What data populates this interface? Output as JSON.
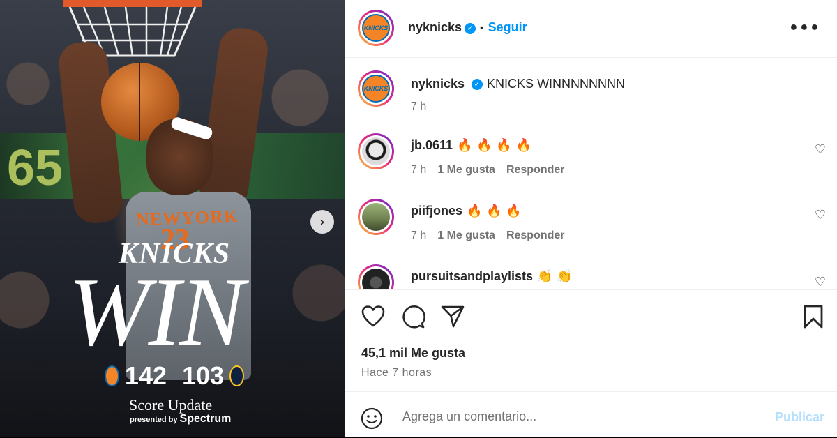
{
  "media": {
    "overlay_small": "KNICKS",
    "overlay_big": "WIN",
    "score_home": "142",
    "score_away": "103",
    "score_update": "Score Update",
    "presented_by": "presented by",
    "sponsor": "Spectrum",
    "jersey_text": "NEWYORK",
    "jersey_number": "23",
    "scoreboard_number": "65",
    "next_icon": "chevron-right-icon"
  },
  "header": {
    "username": "nyknicks",
    "follow_label": "Seguir",
    "separator": "•",
    "more_label": "•••",
    "avatar_text": "KNICKS"
  },
  "caption": {
    "username": "nyknicks",
    "text": "KNICKS WINNNNNNNN",
    "time": "7 h"
  },
  "comments": [
    {
      "username": "jb.0611",
      "text": "🔥 🔥 🔥 🔥",
      "time": "7 h",
      "likes": "1 Me gusta",
      "reply": "Responder"
    },
    {
      "username": "piifjones",
      "text": "🔥 🔥 🔥",
      "time": "7 h",
      "likes": "1 Me gusta",
      "reply": "Responder"
    },
    {
      "username": "pursuitsandplaylists",
      "text": "👏 👏",
      "time": "",
      "likes": "",
      "reply": ""
    }
  ],
  "actions": {
    "likes_count": "45,1 mil Me gusta",
    "posted_ago": "Hace 7 horas"
  },
  "composer": {
    "placeholder": "Agrega un comentario...",
    "publish_label": "Publicar"
  },
  "colors": {
    "link_blue": "#0095f6",
    "publish_disabled": "#b2dffc",
    "knicks_orange": "#f58426",
    "knicks_blue": "#006bb6"
  }
}
